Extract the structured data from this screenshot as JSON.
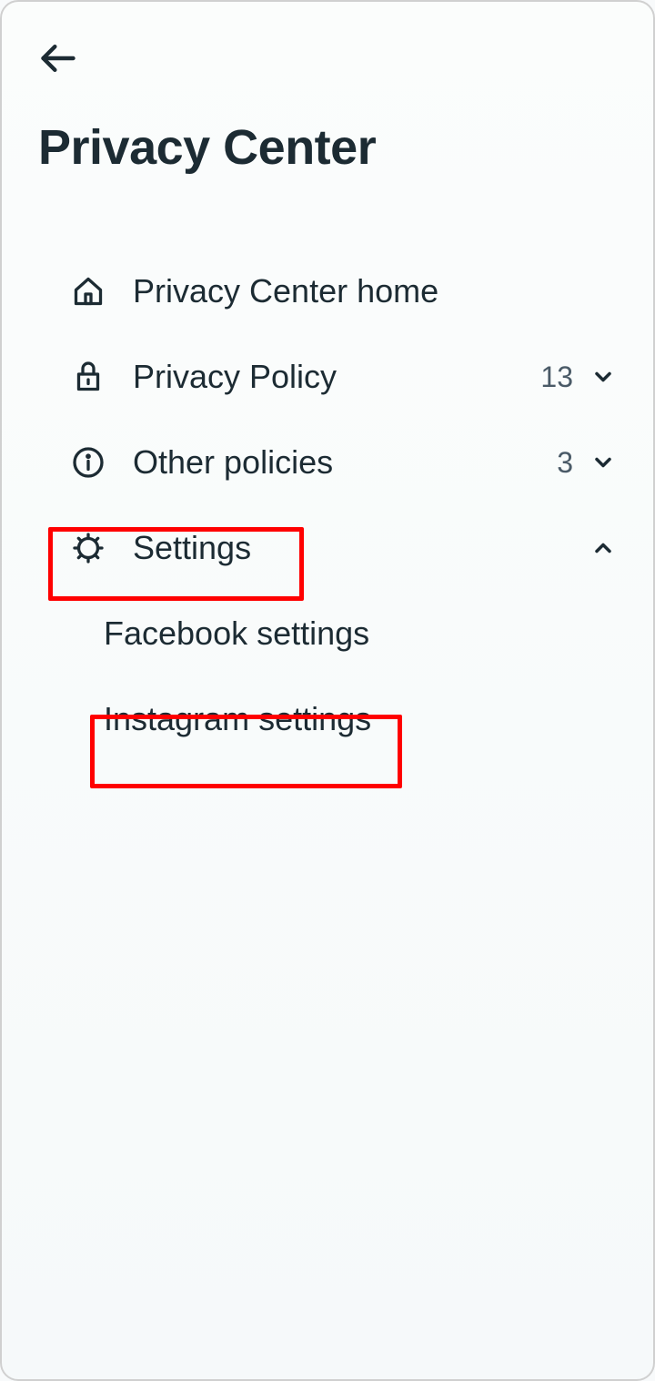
{
  "header": {
    "title": "Privacy Center"
  },
  "nav": {
    "items": [
      {
        "icon": "home",
        "label": "Privacy Center home",
        "count": null,
        "chevron": null
      },
      {
        "icon": "lock",
        "label": "Privacy Policy",
        "count": "13",
        "chevron": "down"
      },
      {
        "icon": "info",
        "label": "Other policies",
        "count": "3",
        "chevron": "down"
      },
      {
        "icon": "gear",
        "label": "Settings",
        "count": null,
        "chevron": "up",
        "subitems": [
          {
            "label": "Facebook settings"
          },
          {
            "label": "Instagram settings"
          }
        ]
      }
    ]
  }
}
